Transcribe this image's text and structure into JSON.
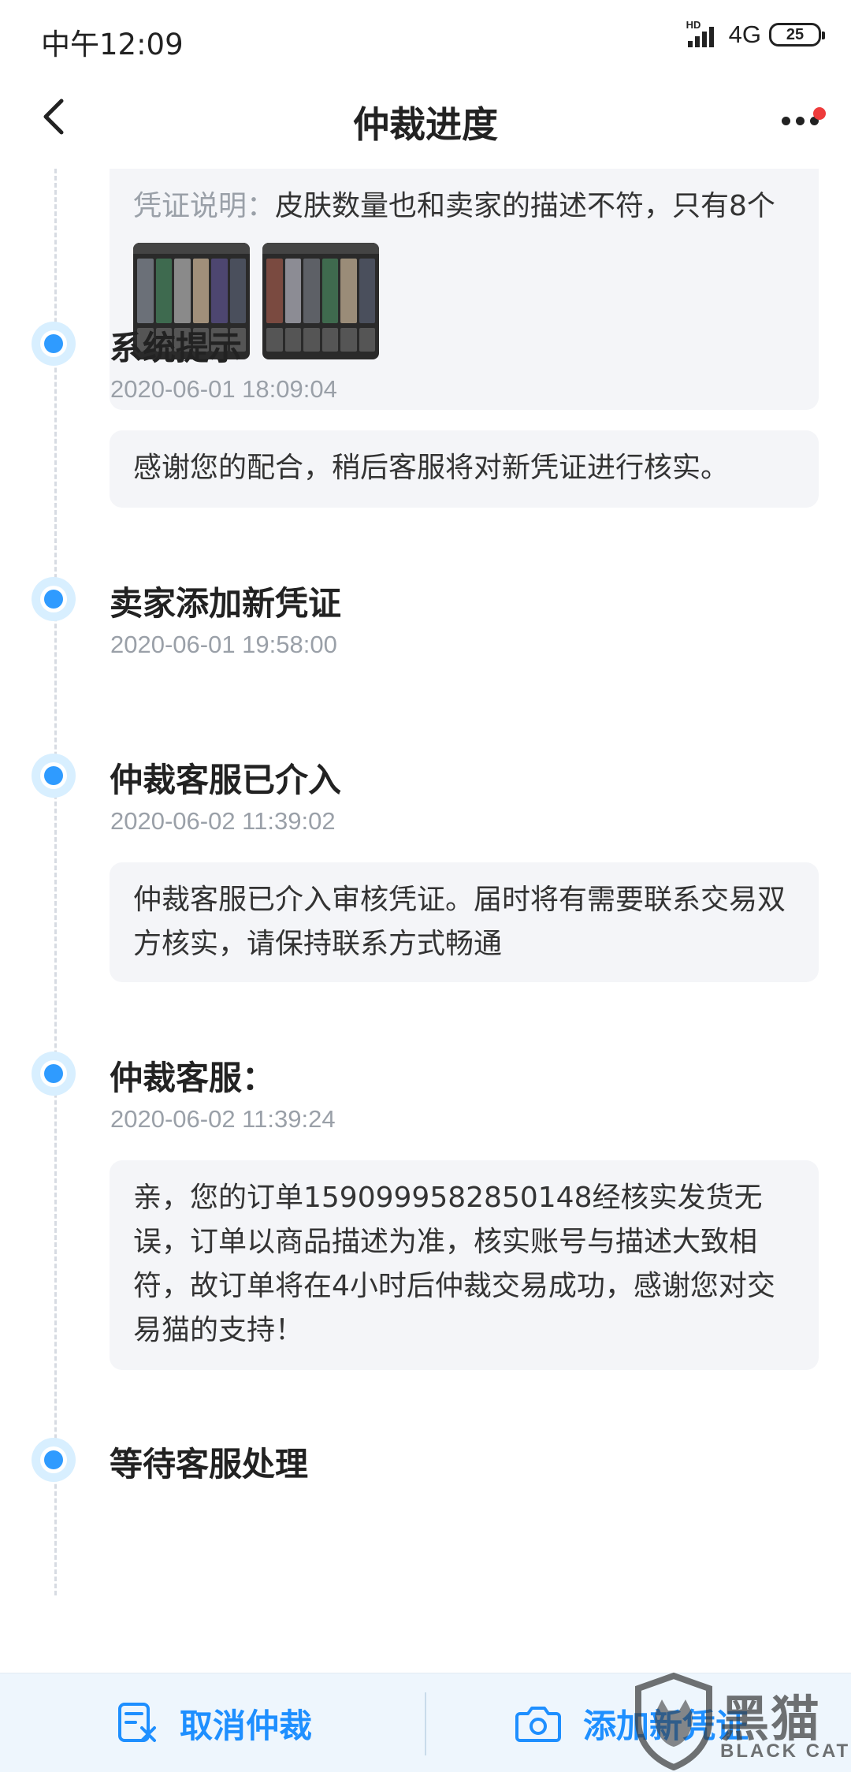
{
  "status_bar": {
    "time": "中午12:09",
    "hd_label": "HD",
    "network": "4G",
    "battery": "25"
  },
  "nav": {
    "title": "仲裁进度"
  },
  "evidence": {
    "label": "凭证说明：",
    "text": "皮肤数量也和卖家的描述不符，只有8个"
  },
  "events": [
    {
      "title": "系统提示",
      "time": "2020-06-01 18:09:04",
      "message": "感谢您的配合，稍后客服将对新凭证进行核实。"
    },
    {
      "title": "卖家添加新凭证",
      "time": "2020-06-01 19:58:00"
    },
    {
      "title": "仲裁客服已介入",
      "time": "2020-06-02 11:39:02",
      "message": "仲裁客服已介入审核凭证。届时将有需要联系交易双方核实，请保持联系方式畅通"
    },
    {
      "title": "仲裁客服：",
      "time": "2020-06-02 11:39:24",
      "message": "亲，您的订单1590999582850148经核实发货无误，订单以商品描述为准，核实账号与描述大致相符，故订单将在4小时后仲裁交易成功，感谢您对交易猫的支持！"
    },
    {
      "title": "等待客服处理"
    }
  ],
  "bottom_bar": {
    "cancel_label": "取消仲裁",
    "add_label": "添加新凭证"
  },
  "watermark": {
    "text": "黑猫",
    "sub": "BLACK CAT"
  },
  "colors": {
    "accent": "#1e8fff",
    "dot": "#2f9bff",
    "card_bg": "#f4f5f8",
    "bottom_bg": "#eef6fd"
  }
}
